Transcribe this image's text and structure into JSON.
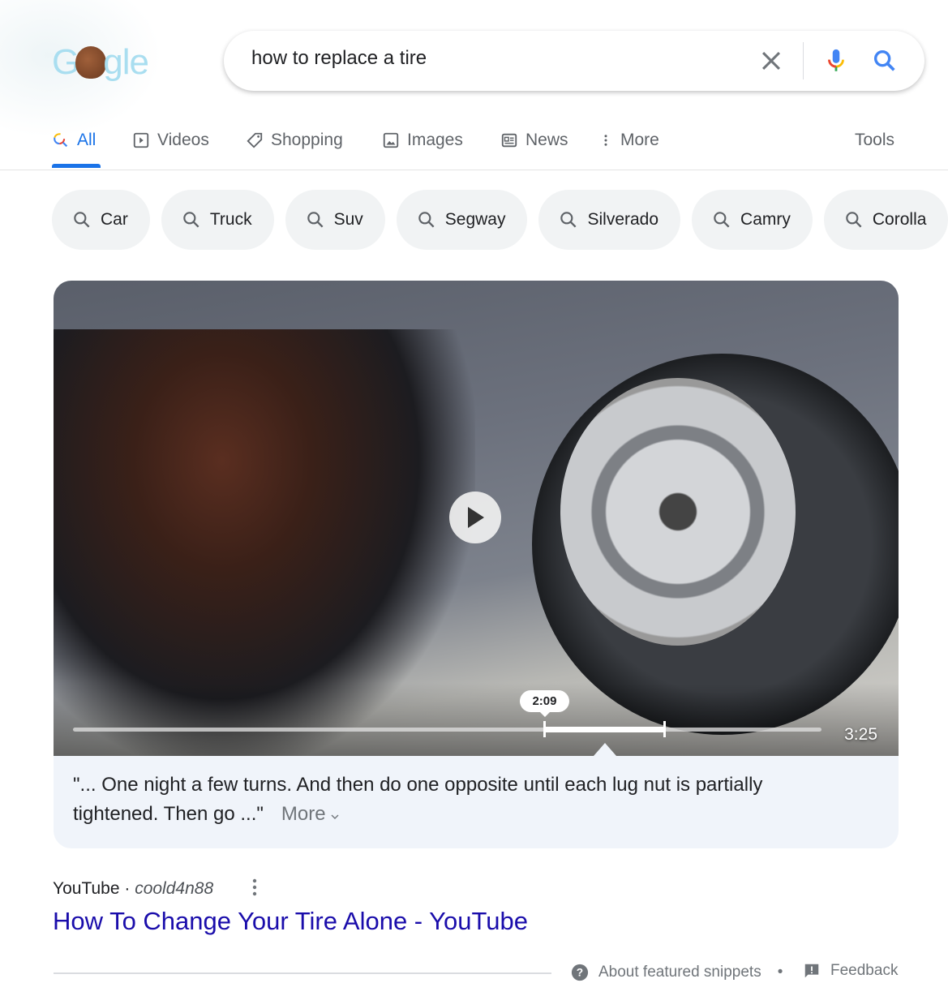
{
  "logo": {
    "text": "Google"
  },
  "search": {
    "query": "how to replace a tire"
  },
  "tabs": [
    {
      "label": "All",
      "icon": "search-icon",
      "active": true
    },
    {
      "label": "Videos",
      "icon": "video-icon"
    },
    {
      "label": "Shopping",
      "icon": "tag-icon"
    },
    {
      "label": "Images",
      "icon": "image-icon"
    },
    {
      "label": "News",
      "icon": "news-icon"
    },
    {
      "label": "More",
      "icon": "kebab-icon"
    }
  ],
  "tools_label": "Tools",
  "chips": [
    "Car",
    "Truck",
    "Suv",
    "Segway",
    "Silverado",
    "Camry",
    "Corolla"
  ],
  "video": {
    "current_time": "2:09",
    "duration": "3:25",
    "progress_fraction": 0.63,
    "clip_end_fraction": 0.79
  },
  "snippet": {
    "quote": "\"... One night a few turns. And then do one opposite until each lug nut is partially tightened. Then go ...\"",
    "more_label": "More"
  },
  "result": {
    "source": "YouTube",
    "author": "coold4n88",
    "title": "How To Change Your Tire Alone - YouTube"
  },
  "footer": {
    "about": "About featured snippets",
    "feedback": "Feedback"
  },
  "colors": {
    "accent": "#1a73e8",
    "link": "#1a0dab",
    "chip_bg": "#f1f3f4",
    "snippet_bg": "#f0f4fa"
  }
}
